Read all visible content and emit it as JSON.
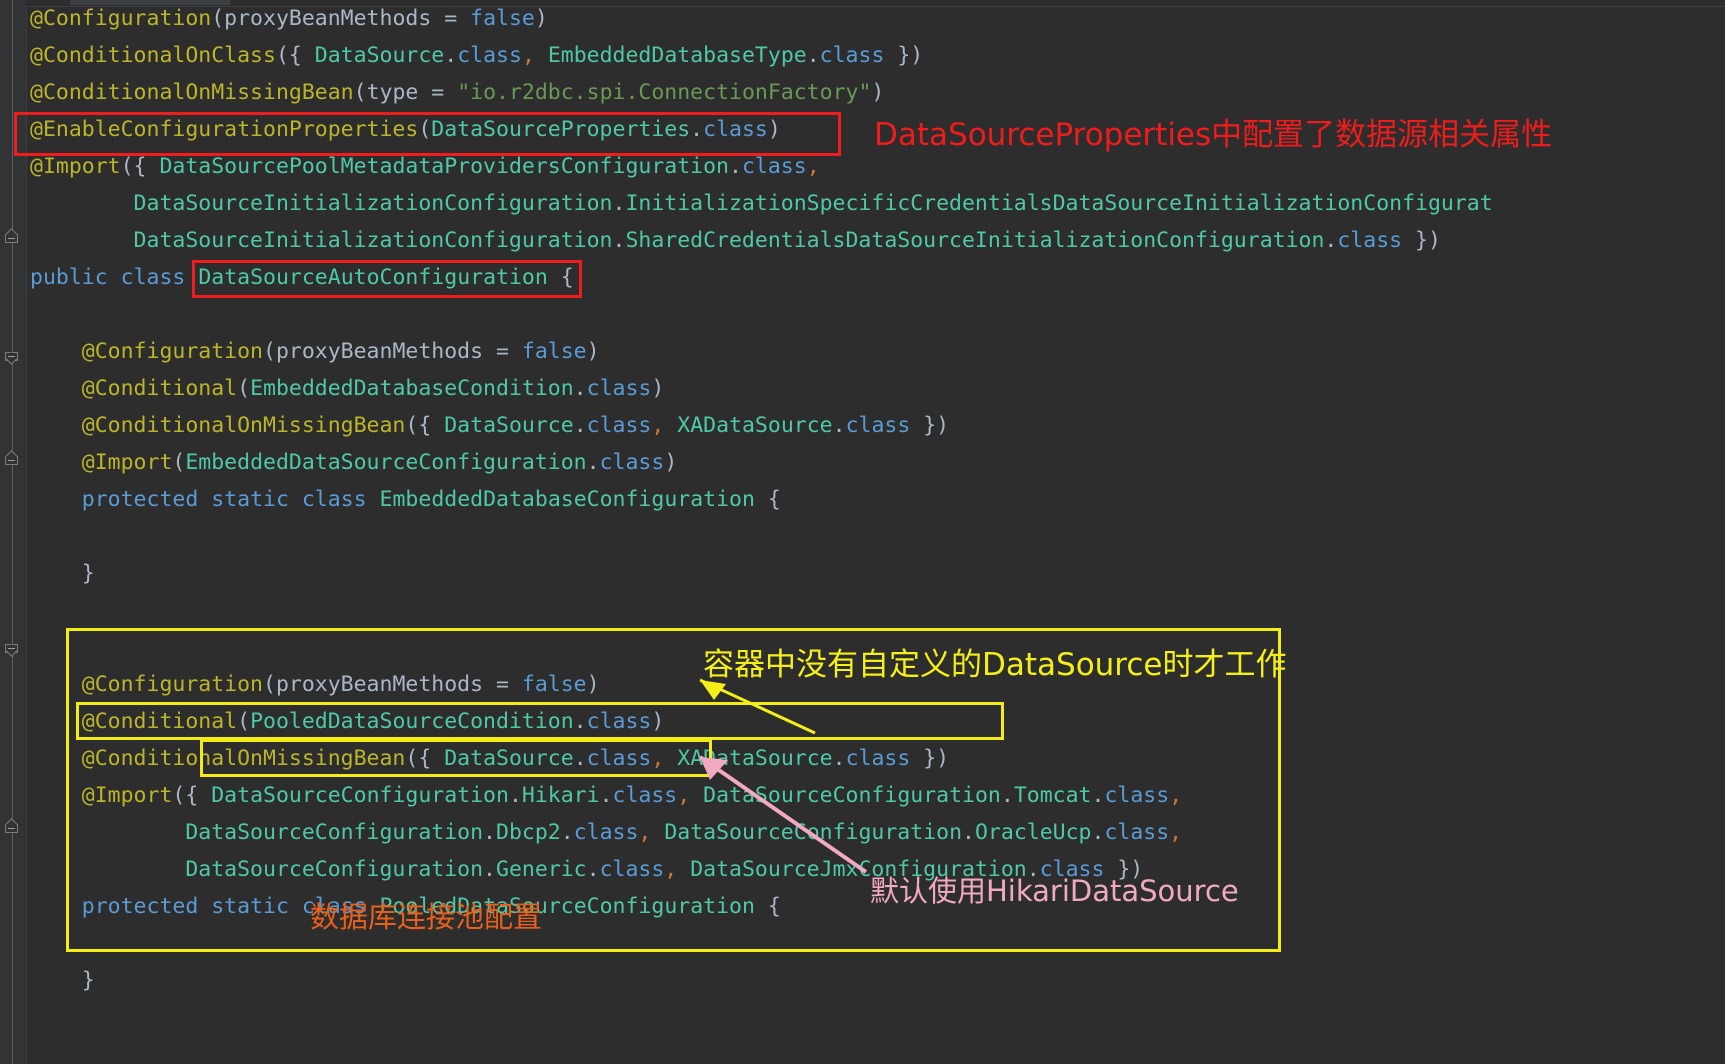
{
  "editor": {
    "theme": "dark",
    "background_color": "#2d2d2d",
    "gutter_color": "#313335",
    "syntax_colors": {
      "annotation": "#bbb529",
      "class_name": "#4ec9a8",
      "keyword": "#5a9bd5",
      "plain": "#a9b7c6",
      "string": "#6a9955",
      "comma": "#cc7832"
    },
    "code_lines": [
      {
        "id": "l1",
        "tokens": [
          {
            "t": "@Configuration",
            "c": "ann"
          },
          {
            "t": "(",
            "c": "pn"
          },
          {
            "t": "proxyBeanMethods",
            "c": "pl"
          },
          {
            "t": " = ",
            "c": "pn"
          },
          {
            "t": "false",
            "c": "kw"
          },
          {
            "t": ")",
            "c": "pn"
          }
        ]
      },
      {
        "id": "l2",
        "tokens": [
          {
            "t": "@ConditionalOnClass",
            "c": "ann"
          },
          {
            "t": "({ ",
            "c": "pn"
          },
          {
            "t": "DataSource",
            "c": "cls"
          },
          {
            "t": ".",
            "c": "pn"
          },
          {
            "t": "class",
            "c": "kw"
          },
          {
            "t": ", ",
            "c": "cm"
          },
          {
            "t": "EmbeddedDatabaseType",
            "c": "cls"
          },
          {
            "t": ".",
            "c": "pn"
          },
          {
            "t": "class",
            "c": "kw"
          },
          {
            "t": " })",
            "c": "pn"
          }
        ]
      },
      {
        "id": "l3",
        "tokens": [
          {
            "t": "@ConditionalOnMissingBean",
            "c": "ann"
          },
          {
            "t": "(",
            "c": "pn"
          },
          {
            "t": "type",
            "c": "pl"
          },
          {
            "t": " = ",
            "c": "pn"
          },
          {
            "t": "\"io.r2dbc.spi.ConnectionFactory\"",
            "c": "str"
          },
          {
            "t": ")",
            "c": "pn"
          }
        ]
      },
      {
        "id": "l4",
        "tokens": [
          {
            "t": "@EnableConfigurationProperties",
            "c": "ann"
          },
          {
            "t": "(",
            "c": "pn"
          },
          {
            "t": "DataSourceProperties",
            "c": "cls"
          },
          {
            "t": ".",
            "c": "pn"
          },
          {
            "t": "class",
            "c": "kw"
          },
          {
            "t": ")",
            "c": "pn"
          }
        ]
      },
      {
        "id": "l5",
        "tokens": [
          {
            "t": "@Import",
            "c": "ann"
          },
          {
            "t": "({ ",
            "c": "pn"
          },
          {
            "t": "DataSourcePoolMetadataProvidersConfiguration",
            "c": "cls"
          },
          {
            "t": ".",
            "c": "pn"
          },
          {
            "t": "class",
            "c": "kw"
          },
          {
            "t": ",",
            "c": "cm"
          }
        ]
      },
      {
        "id": "l6",
        "tokens": [
          {
            "t": "        DataSourceInitializationConfiguration",
            "c": "cls"
          },
          {
            "t": ".",
            "c": "pn"
          },
          {
            "t": "InitializationSpecificCredentialsDataSourceInitializationConfigurat",
            "c": "cls"
          }
        ]
      },
      {
        "id": "l7",
        "tokens": [
          {
            "t": "        DataSourceInitializationConfiguration",
            "c": "cls"
          },
          {
            "t": ".",
            "c": "pn"
          },
          {
            "t": "SharedCredentialsDataSourceInitializationConfiguration",
            "c": "cls"
          },
          {
            "t": ".",
            "c": "pn"
          },
          {
            "t": "class",
            "c": "kw"
          },
          {
            "t": " })",
            "c": "pn"
          }
        ]
      },
      {
        "id": "l8",
        "tokens": [
          {
            "t": "public",
            "c": "kw"
          },
          {
            "t": " ",
            "c": "pn"
          },
          {
            "t": "class",
            "c": "kw"
          },
          {
            "t": " ",
            "c": "pn"
          },
          {
            "t": "DataSourceAutoConfiguration",
            "c": "cls"
          },
          {
            "t": " {",
            "c": "pn"
          }
        ]
      },
      {
        "id": "l9",
        "tokens": []
      },
      {
        "id": "l10",
        "tokens": [
          {
            "t": "    @Configuration",
            "c": "ann"
          },
          {
            "t": "(",
            "c": "pn"
          },
          {
            "t": "proxyBeanMethods",
            "c": "pl"
          },
          {
            "t": " = ",
            "c": "pn"
          },
          {
            "t": "false",
            "c": "kw"
          },
          {
            "t": ")",
            "c": "pn"
          }
        ]
      },
      {
        "id": "l11",
        "tokens": [
          {
            "t": "    @Conditional",
            "c": "ann"
          },
          {
            "t": "(",
            "c": "pn"
          },
          {
            "t": "EmbeddedDatabaseCondition",
            "c": "cls"
          },
          {
            "t": ".",
            "c": "pn"
          },
          {
            "t": "class",
            "c": "kw"
          },
          {
            "t": ")",
            "c": "pn"
          }
        ]
      },
      {
        "id": "l12",
        "tokens": [
          {
            "t": "    @ConditionalOnMissingBean",
            "c": "ann"
          },
          {
            "t": "({ ",
            "c": "pn"
          },
          {
            "t": "DataSource",
            "c": "cls"
          },
          {
            "t": ".",
            "c": "pn"
          },
          {
            "t": "class",
            "c": "kw"
          },
          {
            "t": ", ",
            "c": "cm"
          },
          {
            "t": "XADataSource",
            "c": "cls"
          },
          {
            "t": ".",
            "c": "pn"
          },
          {
            "t": "class",
            "c": "kw"
          },
          {
            "t": " })",
            "c": "pn"
          }
        ]
      },
      {
        "id": "l13",
        "tokens": [
          {
            "t": "    @Import",
            "c": "ann"
          },
          {
            "t": "(",
            "c": "pn"
          },
          {
            "t": "EmbeddedDataSourceConfiguration",
            "c": "cls"
          },
          {
            "t": ".",
            "c": "pn"
          },
          {
            "t": "class",
            "c": "kw"
          },
          {
            "t": ")",
            "c": "pn"
          }
        ]
      },
      {
        "id": "l14",
        "tokens": [
          {
            "t": "    protected",
            "c": "kw"
          },
          {
            "t": " ",
            "c": "pn"
          },
          {
            "t": "static",
            "c": "kw"
          },
          {
            "t": " ",
            "c": "pn"
          },
          {
            "t": "class",
            "c": "kw"
          },
          {
            "t": " ",
            "c": "pn"
          },
          {
            "t": "EmbeddedDatabaseConfiguration",
            "c": "cls"
          },
          {
            "t": " {",
            "c": "pn"
          }
        ]
      },
      {
        "id": "l15",
        "tokens": []
      },
      {
        "id": "l16",
        "tokens": [
          {
            "t": "    }",
            "c": "pn"
          }
        ]
      },
      {
        "id": "l17",
        "tokens": []
      },
      {
        "id": "l18",
        "tokens": []
      },
      {
        "id": "l19",
        "tokens": [
          {
            "t": "    @Configuration",
            "c": "ann"
          },
          {
            "t": "(",
            "c": "pn"
          },
          {
            "t": "proxyBeanMethods",
            "c": "pl"
          },
          {
            "t": " = ",
            "c": "pn"
          },
          {
            "t": "false",
            "c": "kw"
          },
          {
            "t": ")",
            "c": "pn"
          }
        ]
      },
      {
        "id": "l20",
        "tokens": [
          {
            "t": "    @Conditional",
            "c": "ann"
          },
          {
            "t": "(",
            "c": "pn"
          },
          {
            "t": "PooledDataSourceCondition",
            "c": "cls"
          },
          {
            "t": ".",
            "c": "pn"
          },
          {
            "t": "class",
            "c": "kw"
          },
          {
            "t": ")",
            "c": "pn"
          }
        ]
      },
      {
        "id": "l21",
        "tokens": [
          {
            "t": "    @ConditionalOnMissingBean",
            "c": "ann"
          },
          {
            "t": "({ ",
            "c": "pn"
          },
          {
            "t": "DataSource",
            "c": "cls"
          },
          {
            "t": ".",
            "c": "pn"
          },
          {
            "t": "class",
            "c": "kw"
          },
          {
            "t": ", ",
            "c": "cm"
          },
          {
            "t": "XADataSource",
            "c": "cls"
          },
          {
            "t": ".",
            "c": "pn"
          },
          {
            "t": "class",
            "c": "kw"
          },
          {
            "t": " })",
            "c": "pn"
          }
        ]
      },
      {
        "id": "l22",
        "tokens": [
          {
            "t": "    @Import",
            "c": "ann"
          },
          {
            "t": "({ ",
            "c": "pn"
          },
          {
            "t": "DataSourceConfiguration",
            "c": "cls"
          },
          {
            "t": ".",
            "c": "pn"
          },
          {
            "t": "Hikari",
            "c": "cls"
          },
          {
            "t": ".",
            "c": "pn"
          },
          {
            "t": "class",
            "c": "kw"
          },
          {
            "t": ", ",
            "c": "cm"
          },
          {
            "t": "DataSourceConfiguration",
            "c": "cls"
          },
          {
            "t": ".",
            "c": "pn"
          },
          {
            "t": "Tomcat",
            "c": "cls"
          },
          {
            "t": ".",
            "c": "pn"
          },
          {
            "t": "class",
            "c": "kw"
          },
          {
            "t": ",",
            "c": "cm"
          }
        ]
      },
      {
        "id": "l23",
        "tokens": [
          {
            "t": "            DataSourceConfiguration",
            "c": "cls"
          },
          {
            "t": ".",
            "c": "pn"
          },
          {
            "t": "Dbcp2",
            "c": "cls"
          },
          {
            "t": ".",
            "c": "pn"
          },
          {
            "t": "class",
            "c": "kw"
          },
          {
            "t": ", ",
            "c": "cm"
          },
          {
            "t": "DataSourceConfiguration",
            "c": "cls"
          },
          {
            "t": ".",
            "c": "pn"
          },
          {
            "t": "OracleUcp",
            "c": "cls"
          },
          {
            "t": ".",
            "c": "pn"
          },
          {
            "t": "class",
            "c": "kw"
          },
          {
            "t": ",",
            "c": "cm"
          }
        ]
      },
      {
        "id": "l24",
        "tokens": [
          {
            "t": "            DataSourceConfiguration",
            "c": "cls"
          },
          {
            "t": ".",
            "c": "pn"
          },
          {
            "t": "Generic",
            "c": "cls"
          },
          {
            "t": ".",
            "c": "pn"
          },
          {
            "t": "class",
            "c": "kw"
          },
          {
            "t": ", ",
            "c": "cm"
          },
          {
            "t": "DataSourceJmxConfiguration",
            "c": "cls"
          },
          {
            "t": ".",
            "c": "pn"
          },
          {
            "t": "class",
            "c": "kw"
          },
          {
            "t": " })",
            "c": "pn"
          }
        ]
      },
      {
        "id": "l25",
        "tokens": [
          {
            "t": "    protected",
            "c": "kw"
          },
          {
            "t": " ",
            "c": "pn"
          },
          {
            "t": "static",
            "c": "kw"
          },
          {
            "t": " ",
            "c": "pn"
          },
          {
            "t": "class",
            "c": "kw"
          },
          {
            "t": " ",
            "c": "pn"
          },
          {
            "t": "PooledDataSourceConfiguration",
            "c": "cls"
          },
          {
            "t": " {",
            "c": "pn"
          }
        ]
      },
      {
        "id": "l26",
        "tokens": []
      },
      {
        "id": "l27",
        "tokens": [
          {
            "t": "    }",
            "c": "pn"
          }
        ]
      }
    ]
  },
  "annotations": {
    "highlight_boxes": [
      {
        "id": "box-enable-config-props",
        "color": "#ef1d1d",
        "target": "@EnableConfigurationProperties(DataSourceProperties.class)"
      },
      {
        "id": "box-class-name",
        "color": "#ef1d1d",
        "target": "DataSourceAutoConfiguration"
      },
      {
        "id": "box-pooled-block",
        "color": "#f3ec15",
        "target": "PooledDataSourceConfiguration block"
      },
      {
        "id": "box-conditional-missing-bean",
        "color": "#f3ec15",
        "target": "@ConditionalOnMissingBean({ DataSource.class, XADataSource.class })"
      },
      {
        "id": "box-hikari",
        "color": "#f3ec15",
        "target": "DataSourceConfiguration.Hikari.class"
      }
    ],
    "notes": [
      {
        "id": "note-datasource-properties",
        "text": "DataSourceProperties中配置了数据源相关属性",
        "color": "#ee1c1c",
        "style": "red"
      },
      {
        "id": "note-no-custom-datasource",
        "text": "容器中没有自定义的DataSource时才工作",
        "color": "#f5ef18",
        "style": "yellow"
      },
      {
        "id": "note-default-hikari",
        "text": "默认使用HikariDataSource",
        "color": "#f0a9c0",
        "style": "pink"
      },
      {
        "id": "note-connection-pool",
        "text": "数据库连接池配置",
        "color": "#e8601c",
        "style": "orange"
      }
    ],
    "arrows": [
      {
        "id": "arrow-yellow",
        "color": "#f5ef18",
        "from": "note-no-custom-datasource",
        "to": "box-conditional-missing-bean"
      },
      {
        "id": "arrow-pink",
        "color": "#f0a9c0",
        "from": "note-default-hikari",
        "to": "box-hikari"
      }
    ]
  }
}
